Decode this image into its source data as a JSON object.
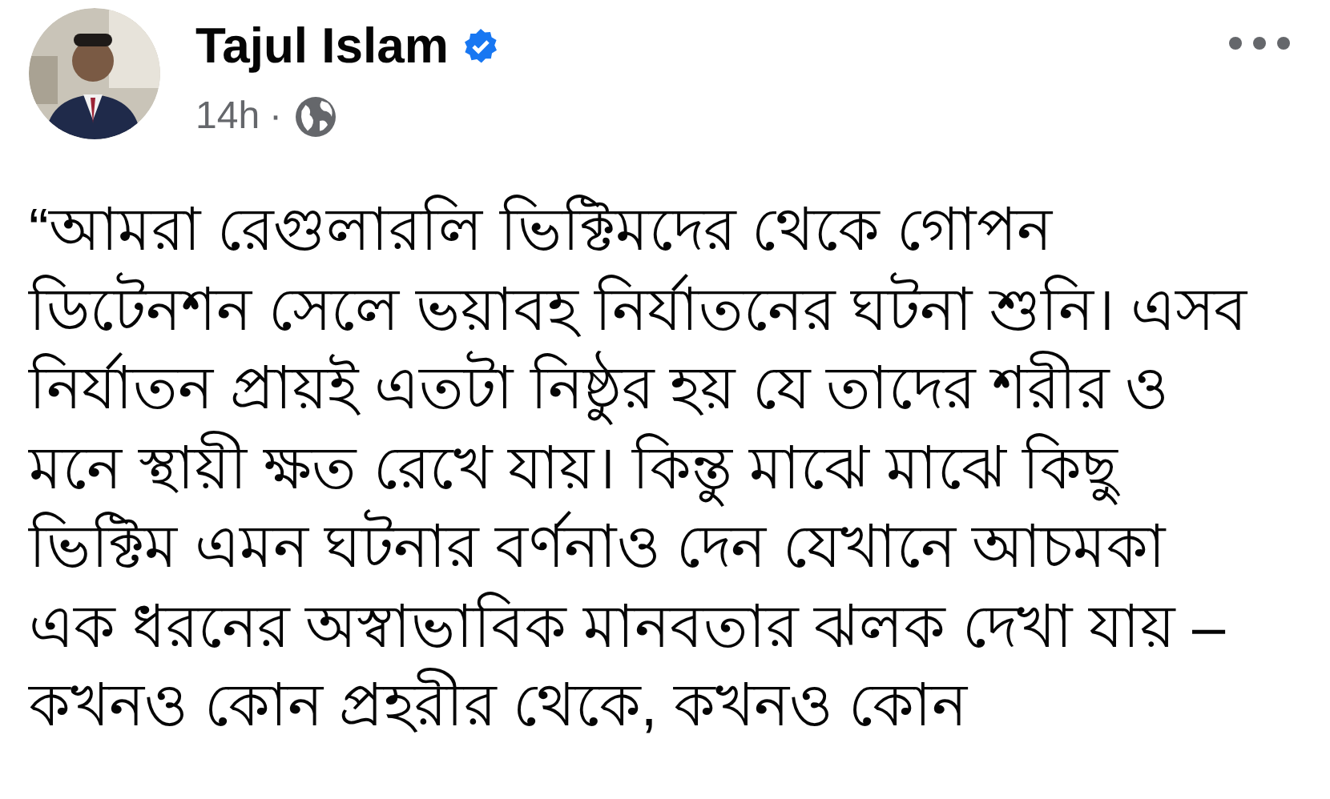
{
  "author": {
    "name": "Tajul Islam",
    "verified": true
  },
  "meta": {
    "time": "14h",
    "separator": "·"
  },
  "body_lines": [
    "“আমরা রেগুলারলি ভিক্টিমদের থেকে গোপন",
    "ডিটেনশন সেলে ভয়াবহ নির্যাতনের ঘটনা শুনি। এসব",
    "নির্যাতন প্রায়ই এতটা নিষ্ঠুর হয় যে তাদের শরীর ও",
    "মনে স্থায়ী ক্ষত রেখে যায়। কিন্তু মাঝে মাঝে কিছু",
    "ভিক্টিম এমন ঘটনার বর্ণনাও দেন যেখানে আচমকা",
    "এক ধরনের অস্বাভাবিক মানবতার ঝলক দেখা যায় –",
    "কখনও কোন প্রহরীর থেকে, কখনও কোন"
  ]
}
